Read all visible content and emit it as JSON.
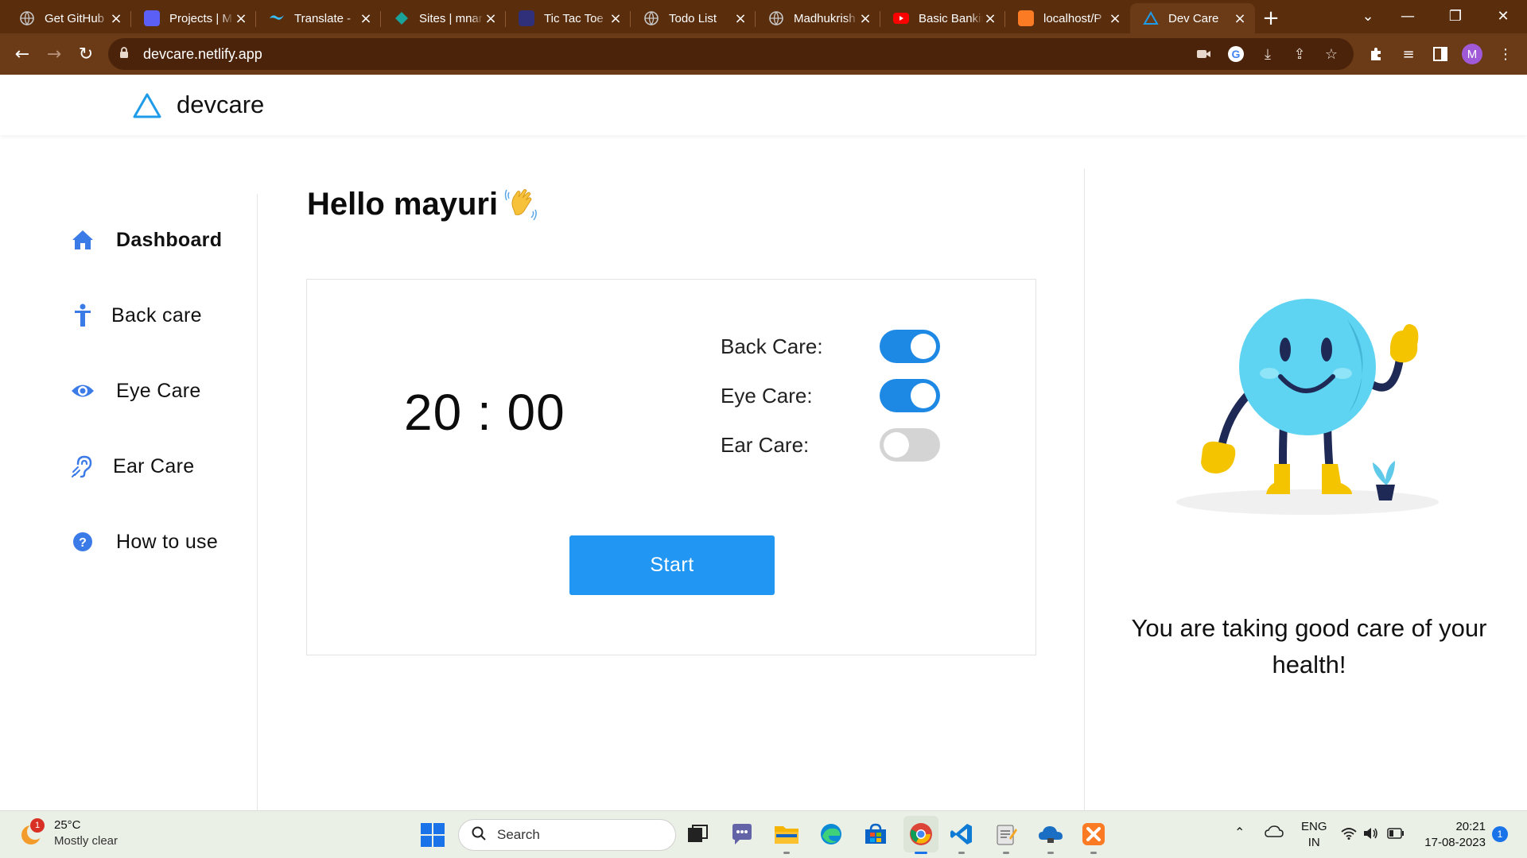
{
  "browser": {
    "tabs": [
      {
        "label": "Get GitHub",
        "favicon": "openai-icon",
        "color": "#9aa0a6"
      },
      {
        "label": "Projects | M",
        "favicon": "s-logo-icon",
        "color": "#5b5ff5"
      },
      {
        "label": "Translate - ",
        "favicon": "tailwind-icon",
        "color": "#38bdf8"
      },
      {
        "label": "Sites | mnar",
        "favicon": "diamond-icon",
        "color": "#1aa39a"
      },
      {
        "label": "Tic Tac Toe ",
        "favicon": "grid-icon",
        "color": "#2f2f7a"
      },
      {
        "label": "Todo List",
        "favicon": "globe-icon",
        "color": "#9aa0a6"
      },
      {
        "label": "Madhukrish",
        "favicon": "globe-icon",
        "color": "#9aa0a6"
      },
      {
        "label": "Basic Bankir",
        "favicon": "youtube-icon",
        "color": "#ff0000"
      },
      {
        "label": "localhost/P",
        "favicon": "xampp-icon",
        "color": "#fb7a24"
      },
      {
        "label": "Dev Care",
        "favicon": "devcare-triangle-icon",
        "color": "#1e9be9",
        "active": true
      }
    ],
    "url": "devcare.netlify.app",
    "profile_initial": "M"
  },
  "site": {
    "brand": "devcare",
    "accent": "#1e88e5"
  },
  "sidebar": {
    "items": [
      {
        "label": "Dashboard",
        "icon": "home-icon",
        "active": true
      },
      {
        "label": "Back care",
        "icon": "person-icon"
      },
      {
        "label": "Eye Care",
        "icon": "eye-icon"
      },
      {
        "label": "Ear Care",
        "icon": "ear-icon"
      },
      {
        "label": "How to use",
        "icon": "help-icon"
      }
    ]
  },
  "main": {
    "greeting": "Hello mayuri",
    "timer": "20 : 00",
    "care_options": [
      {
        "label": "Back Care:",
        "enabled": true
      },
      {
        "label": "Eye Care:",
        "enabled": true
      },
      {
        "label": "Ear Care:",
        "enabled": false
      }
    ],
    "start_label": "Start"
  },
  "right_panel": {
    "message": "You are taking good care of your health!"
  },
  "taskbar": {
    "weather_temp": "25°C",
    "weather_cond": "Mostly clear",
    "weather_badge": "1",
    "search_placeholder": "Search",
    "lang_line1": "ENG",
    "lang_line2": "IN",
    "time": "20:21",
    "date": "17-08-2023",
    "notification_count": "1"
  }
}
